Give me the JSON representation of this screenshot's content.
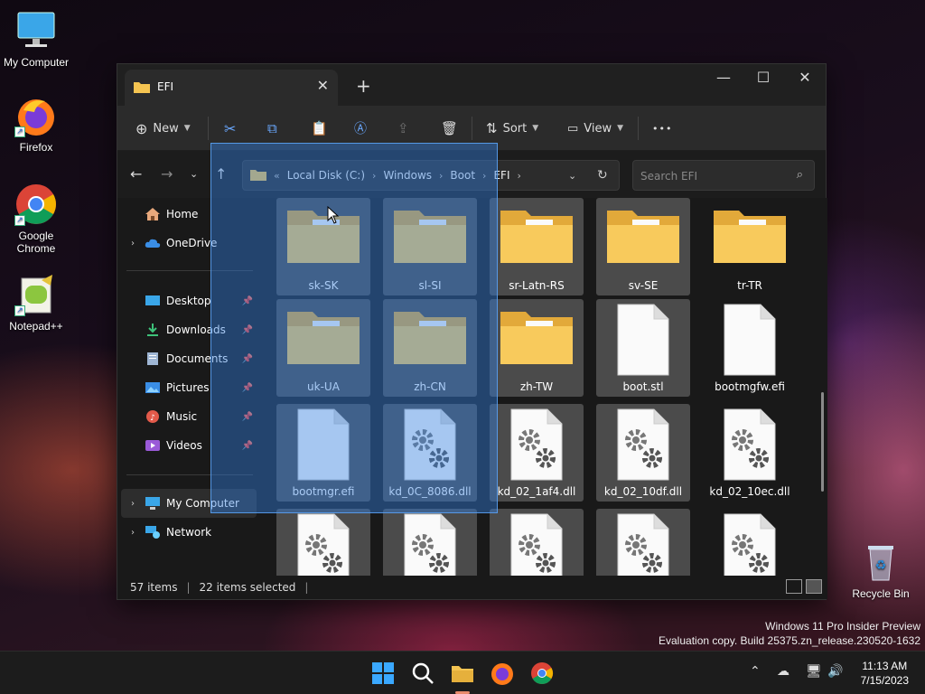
{
  "desktop": {
    "icons": [
      {
        "label": "My Computer"
      },
      {
        "label": "Firefox"
      },
      {
        "label": "Google Chrome"
      },
      {
        "label": "Notepad++"
      },
      {
        "label": "Recycle Bin"
      }
    ]
  },
  "window": {
    "tab_title": "EFI",
    "toolbar": {
      "new_label": "New",
      "sort_label": "Sort",
      "view_label": "View",
      "more_label": "•••"
    },
    "breadcrumb": [
      "Local Disk (C:)",
      "Windows",
      "Boot",
      "EFI"
    ],
    "breadcrumb_overflow": "«",
    "search_placeholder": "Search EFI",
    "sidebar": {
      "home": "Home",
      "onedrive": "OneDrive",
      "quick": [
        "Desktop",
        "Downloads",
        "Documents",
        "Pictures",
        "Music",
        "Videos"
      ],
      "my_computer": "My Computer",
      "network": "Network"
    },
    "files": [
      {
        "name": "sk-SK",
        "type": "folder"
      },
      {
        "name": "sl-SI",
        "type": "folder"
      },
      {
        "name": "sr-Latn-RS",
        "type": "folder"
      },
      {
        "name": "sv-SE",
        "type": "folder"
      },
      {
        "name": "tr-TR",
        "type": "folder"
      },
      {
        "name": "uk-UA",
        "type": "folder"
      },
      {
        "name": "zh-CN",
        "type": "folder"
      },
      {
        "name": "zh-TW",
        "type": "folder"
      },
      {
        "name": "boot.stl",
        "type": "file"
      },
      {
        "name": "bootmgfw.efi",
        "type": "file"
      },
      {
        "name": "bootmgr.efi",
        "type": "file"
      },
      {
        "name": "kd_0C_8086.dll",
        "type": "dll"
      },
      {
        "name": "kd_02_1af4.dll",
        "type": "dll"
      },
      {
        "name": "kd_02_10df.dll",
        "type": "dll"
      },
      {
        "name": "kd_02_10ec.dll",
        "type": "dll"
      }
    ],
    "status": {
      "item_count": "57 items",
      "selected": "22 items selected"
    }
  },
  "watermark": {
    "line1": "Windows 11 Pro Insider Preview",
    "line2": "Evaluation copy. Build 25375.zn_release.230520-1632"
  },
  "taskbar": {
    "time": "11:13 AM",
    "date": "7/15/2023"
  },
  "colors": {
    "folder": "#F5C451",
    "selection": "#3380E4",
    "accent": "#0A84FF"
  }
}
